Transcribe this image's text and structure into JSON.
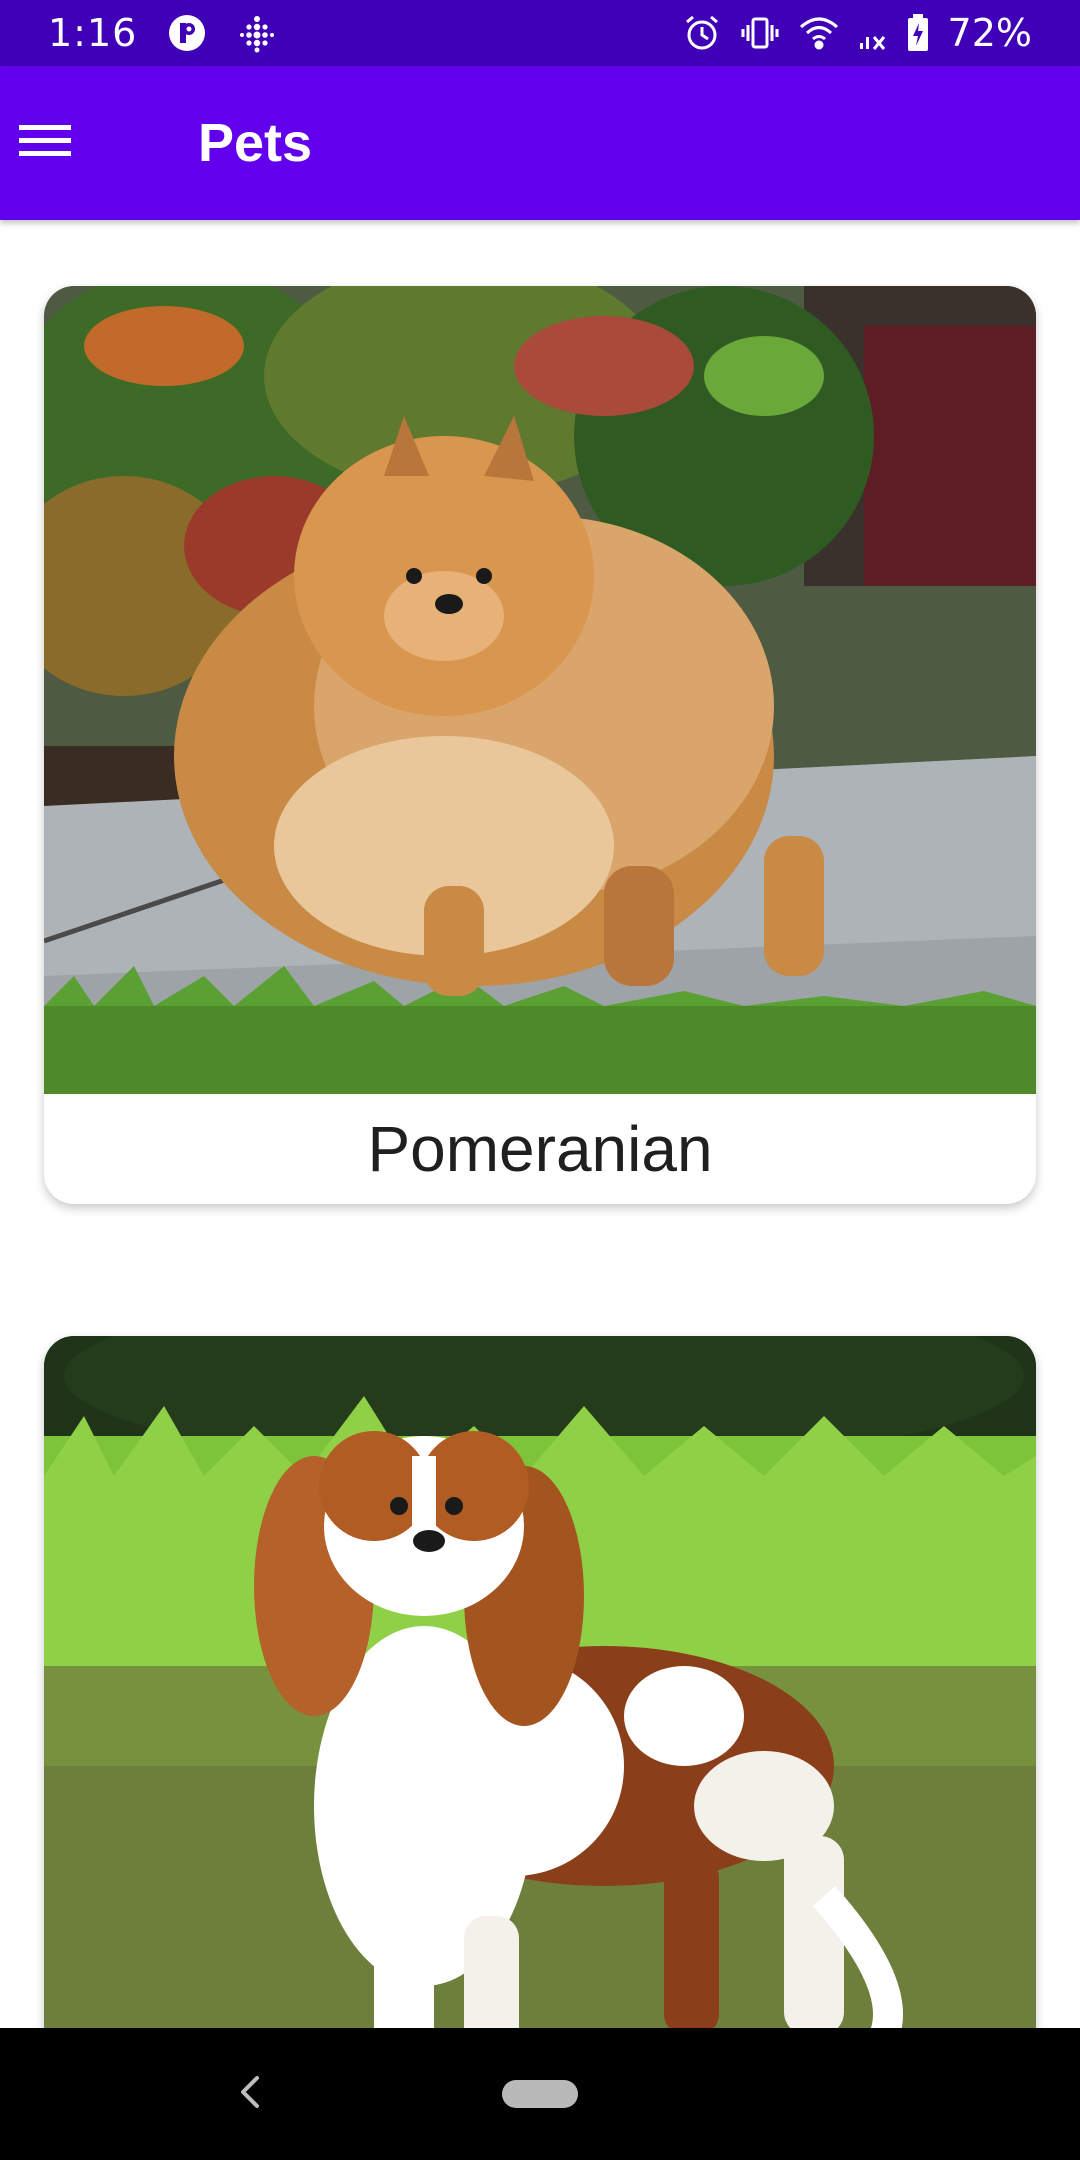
{
  "status_bar": {
    "time": "1:16",
    "battery": "72%",
    "icons": [
      "app-notification-icon",
      "fitbit-icon",
      "alarm-icon",
      "vibrate-icon",
      "wifi-icon",
      "no-signal-icon",
      "battery-charging-icon"
    ]
  },
  "app_bar": {
    "menu_icon": "hamburger-menu-icon",
    "title": "Pets"
  },
  "pets": [
    {
      "name": "Pomeranian",
      "image": "pomeranian-photo"
    },
    {
      "name": "",
      "image": "cavalier-king-charles-spaniel-photo"
    }
  ],
  "nav_bar": {
    "icons": [
      "back-icon",
      "home-pill-icon"
    ]
  },
  "colors": {
    "status_bar": "#3f00b8",
    "app_bar": "#6200ee",
    "background": "#ffffff",
    "nav_bar": "#000000"
  }
}
